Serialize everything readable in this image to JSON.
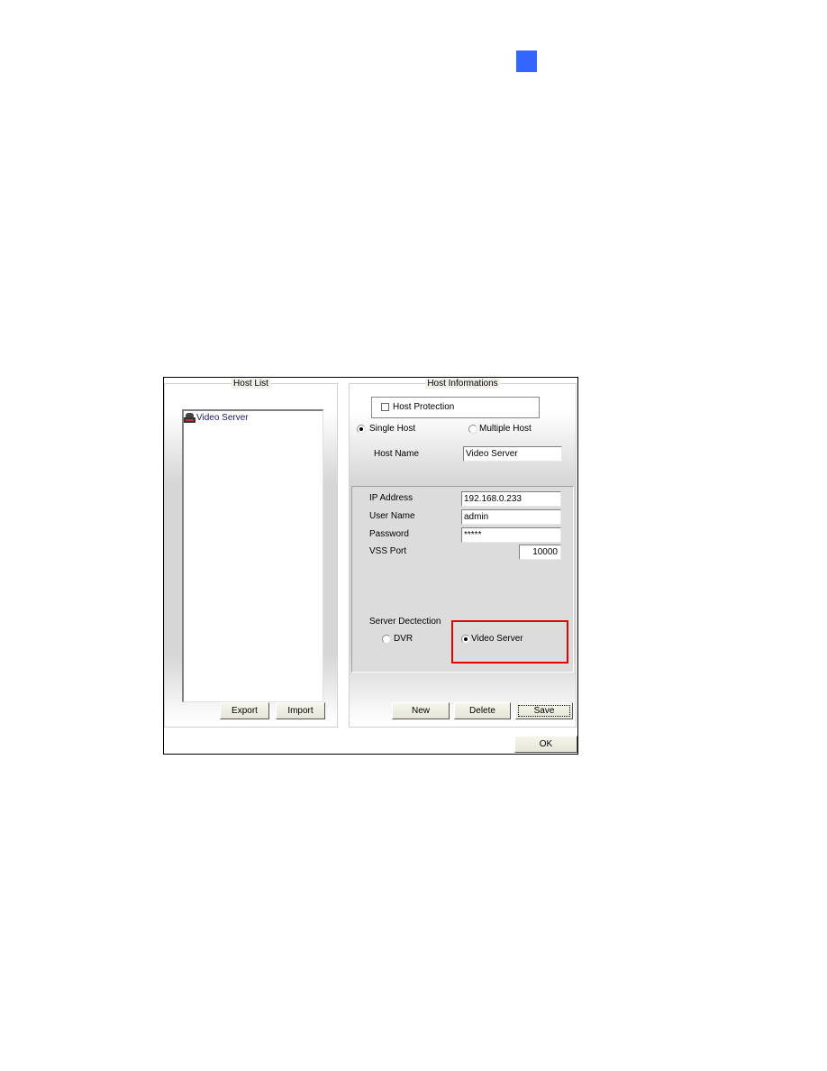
{
  "page_marker": {
    "color": "#3366ff"
  },
  "dialog": {
    "host_list": {
      "title": "Host List",
      "items": [
        {
          "icon": "server-icon",
          "label": "Video Server"
        }
      ],
      "export_label": "Export",
      "import_label": "Import"
    },
    "host_info": {
      "title": "Host Informations",
      "host_protection": {
        "label": "Host Protection",
        "checked": false
      },
      "mode": {
        "single_label": "Single Host",
        "multiple_label": "Multiple Host",
        "selected": "Single Host"
      },
      "host_name": {
        "label": "Host Name",
        "value": "Video Server"
      },
      "ip_address": {
        "label": "IP Address",
        "value": "192.168.0.233"
      },
      "user_name": {
        "label": "User Name",
        "value": "admin"
      },
      "password": {
        "label": "Password",
        "value": "*****"
      },
      "vss_port": {
        "label": "VSS Port",
        "value": "10000"
      },
      "server_detection": {
        "label": "Server Dectection",
        "dvr_label": "DVR",
        "video_server_label": "Video Server",
        "selected": "Video Server",
        "highlight_color": "#e00000"
      },
      "new_label": "New",
      "delete_label": "Delete",
      "save_label": "Save"
    },
    "ok_label": "OK"
  }
}
